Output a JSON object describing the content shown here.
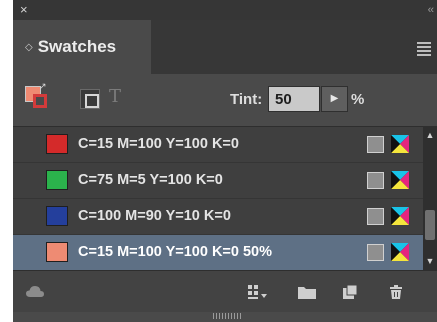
{
  "window": {
    "close_glyph": "×",
    "collapse_glyph": "‹‹"
  },
  "panel": {
    "tab_label": "Swatches",
    "tab_arrows_glyph": "◇",
    "menu_icon": "hamburger-menu-icon"
  },
  "toolbar": {
    "text_button_glyph": "T",
    "tint_label": "Tint:",
    "tint_value": "50",
    "tint_arrow_glyph": "▶",
    "tint_unit": "%"
  },
  "swatches": [
    {
      "name": "C=15 M=100 Y=100 K=0",
      "color": "#d42a2a",
      "selected": false
    },
    {
      "name": "C=75 M=5 Y=100 K=0",
      "color": "#2bb24c",
      "selected": false
    },
    {
      "name": "C=100 M=90 Y=10 K=0",
      "color": "#243f9c",
      "selected": false
    },
    {
      "name": "C=15 M=100 Y=100 K=0 50%",
      "color": "#ee8b73",
      "selected": true
    }
  ],
  "colors": {
    "panel_bg": "#4a4a4a",
    "selected_row": "#5e7085",
    "fill_swatch": "#ef8a72",
    "stroke_swatch": "#d33b3b"
  },
  "bottom_icons": [
    "cc-libraries-icon",
    "show-swatch-kinds-icon",
    "new-color-group-icon",
    "new-swatch-icon",
    "delete-icon"
  ]
}
